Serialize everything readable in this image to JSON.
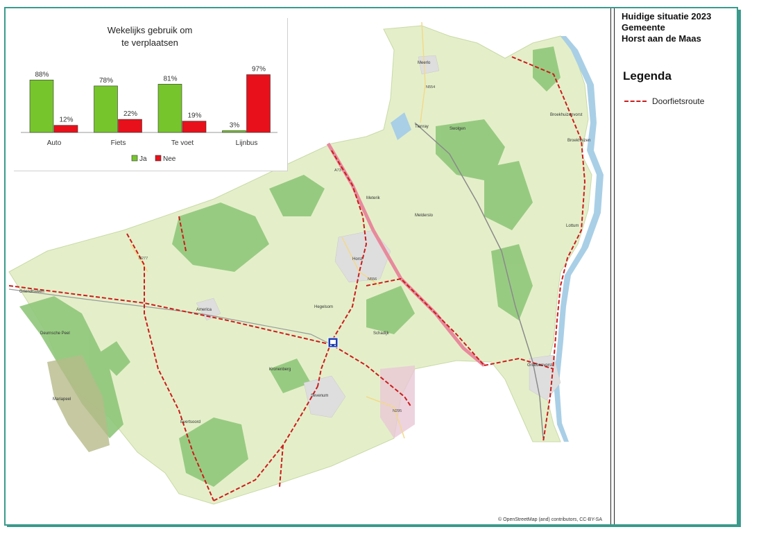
{
  "map_info": {
    "title_lines": [
      "Huidige situatie 2023",
      "Gemeente",
      "Horst aan de Maas"
    ],
    "legend_heading": "Legenda",
    "legend_items": [
      {
        "label": "Doorfietsroute",
        "style": "dashed-line",
        "color": "#cc1c1c"
      }
    ],
    "copyright": "© OpenStreetMap (and) contributors, CC-BY-SA",
    "icons": [
      "bus-station-icon"
    ],
    "colors": {
      "land": "#e4efc9",
      "forest": "#8fc77a",
      "water": "#a9cfe6",
      "urban": "#dedede",
      "highway": "#e8899c",
      "route": "#cc1c1c",
      "frame": "#3a9a8c"
    },
    "place_labels": [
      "Meerlo",
      "Tienray",
      "Swolgen",
      "Broekhuizenvorst",
      "Broekhuizen",
      "Meterik",
      "Melderslo",
      "Horst",
      "Hegelsom",
      "America",
      "Kronenberg",
      "Sevenum",
      "Evertsoord",
      "Grubbenvorst",
      "Lottum",
      "Deurnsche Peel",
      "Mariapeel",
      "Griendtsveen",
      "Schadijk"
    ],
    "road_labels": [
      "A73",
      "N554",
      "N556",
      "N277",
      "N295"
    ]
  },
  "chart_data": {
    "type": "bar",
    "title": "Wekelijks gebruik om te verplaatsen",
    "title_lines": [
      "Wekelijks gebruik om",
      "te verplaatsen"
    ],
    "categories": [
      "Auto",
      "Fiets",
      "Te voet",
      "Lijnbus"
    ],
    "series": [
      {
        "name": "Ja",
        "color": "#77c52d",
        "values": [
          88,
          78,
          81,
          3
        ],
        "labels": [
          "88%",
          "78%",
          "81%",
          "3%"
        ]
      },
      {
        "name": "Nee",
        "color": "#e8101a",
        "values": [
          12,
          22,
          19,
          97
        ],
        "labels": [
          "12%",
          "22%",
          "19%",
          "97%"
        ]
      }
    ],
    "ylim": [
      0,
      100
    ],
    "legend_position": "bottom",
    "grid": false
  }
}
